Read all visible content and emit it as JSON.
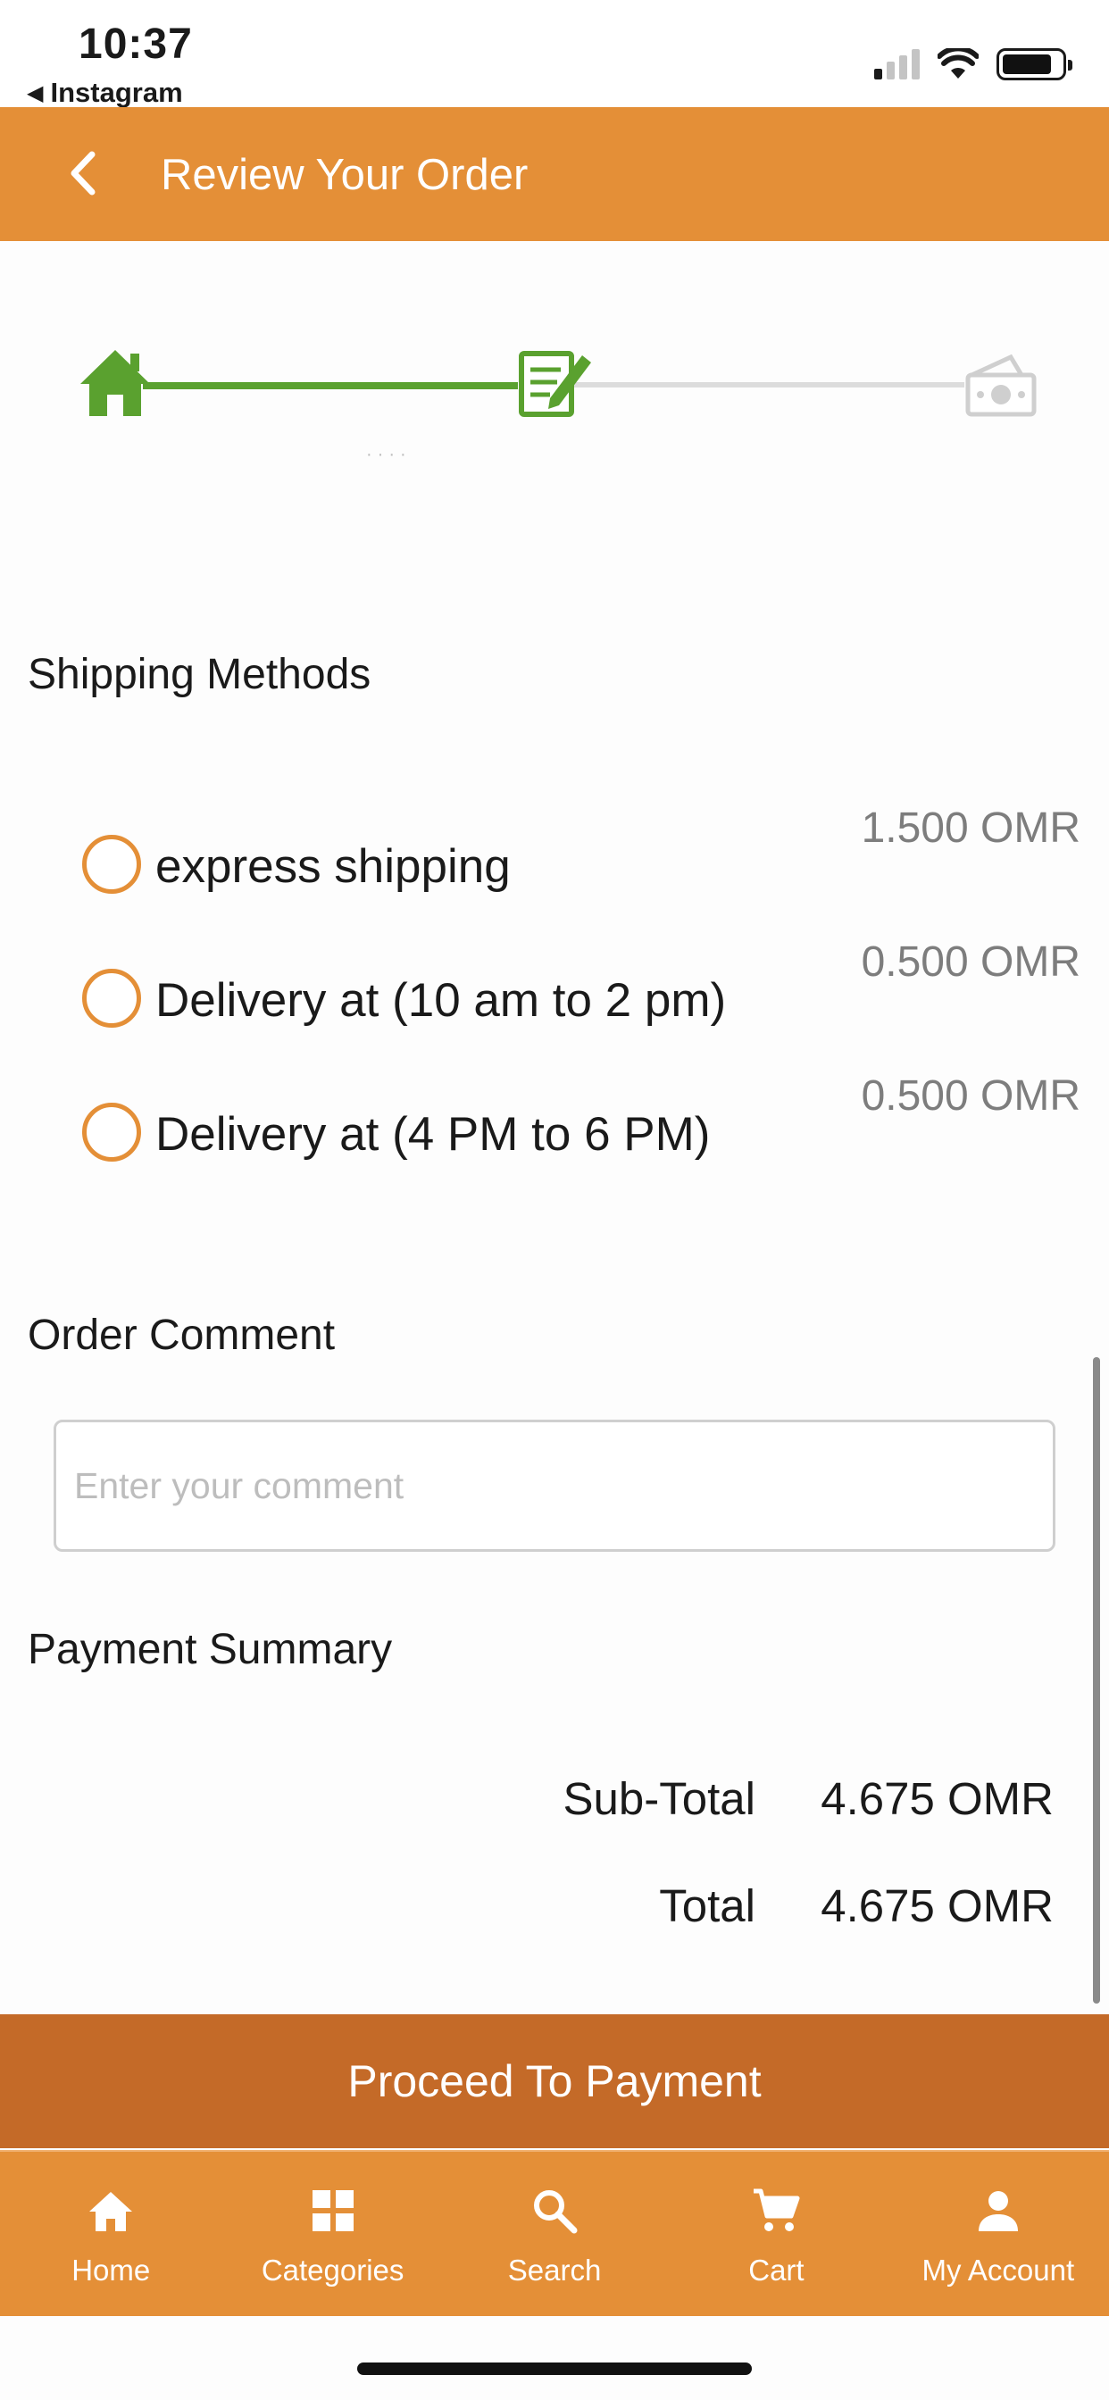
{
  "status_bar": {
    "time": "10:37",
    "back_app": "Instagram"
  },
  "header": {
    "title": "Review Your Order",
    "back_icon": "chevron-left-icon"
  },
  "progress": {
    "steps": [
      {
        "icon": "home-icon",
        "state": "done",
        "color": "#5aa12f"
      },
      {
        "icon": "edit-icon",
        "state": "current",
        "color": "#5aa12f"
      },
      {
        "icon": "money-icon",
        "state": "pending",
        "color": "#cfcfcf"
      }
    ]
  },
  "shipping": {
    "title": "Shipping Methods",
    "methods": [
      {
        "label": "express shipping",
        "price": "1.500 OMR"
      },
      {
        "label": "Delivery at (10 am to 2 pm)",
        "price": "0.500 OMR"
      },
      {
        "label": "Delivery at (4 PM to 6 PM)",
        "price": "0.500 OMR"
      }
    ]
  },
  "comment": {
    "title": "Order Comment",
    "placeholder": "Enter your comment",
    "value": ""
  },
  "summary": {
    "title": "Payment Summary",
    "rows": [
      {
        "label": "Sub-Total",
        "value": "4.675 OMR"
      },
      {
        "label": "Total",
        "value": "4.675 OMR"
      }
    ]
  },
  "actions": {
    "proceed_label": "Proceed To Payment"
  },
  "tabs": [
    {
      "label": "Home",
      "icon": "home-icon"
    },
    {
      "label": "Categories",
      "icon": "grid-icon"
    },
    {
      "label": "Search",
      "icon": "search-icon"
    },
    {
      "label": "Cart",
      "icon": "cart-icon"
    },
    {
      "label": "My Account",
      "icon": "person-icon"
    }
  ],
  "colors": {
    "brand_orange": "#e48f37",
    "button_dark_orange": "#c46a28",
    "progress_green": "#5aa12f"
  }
}
